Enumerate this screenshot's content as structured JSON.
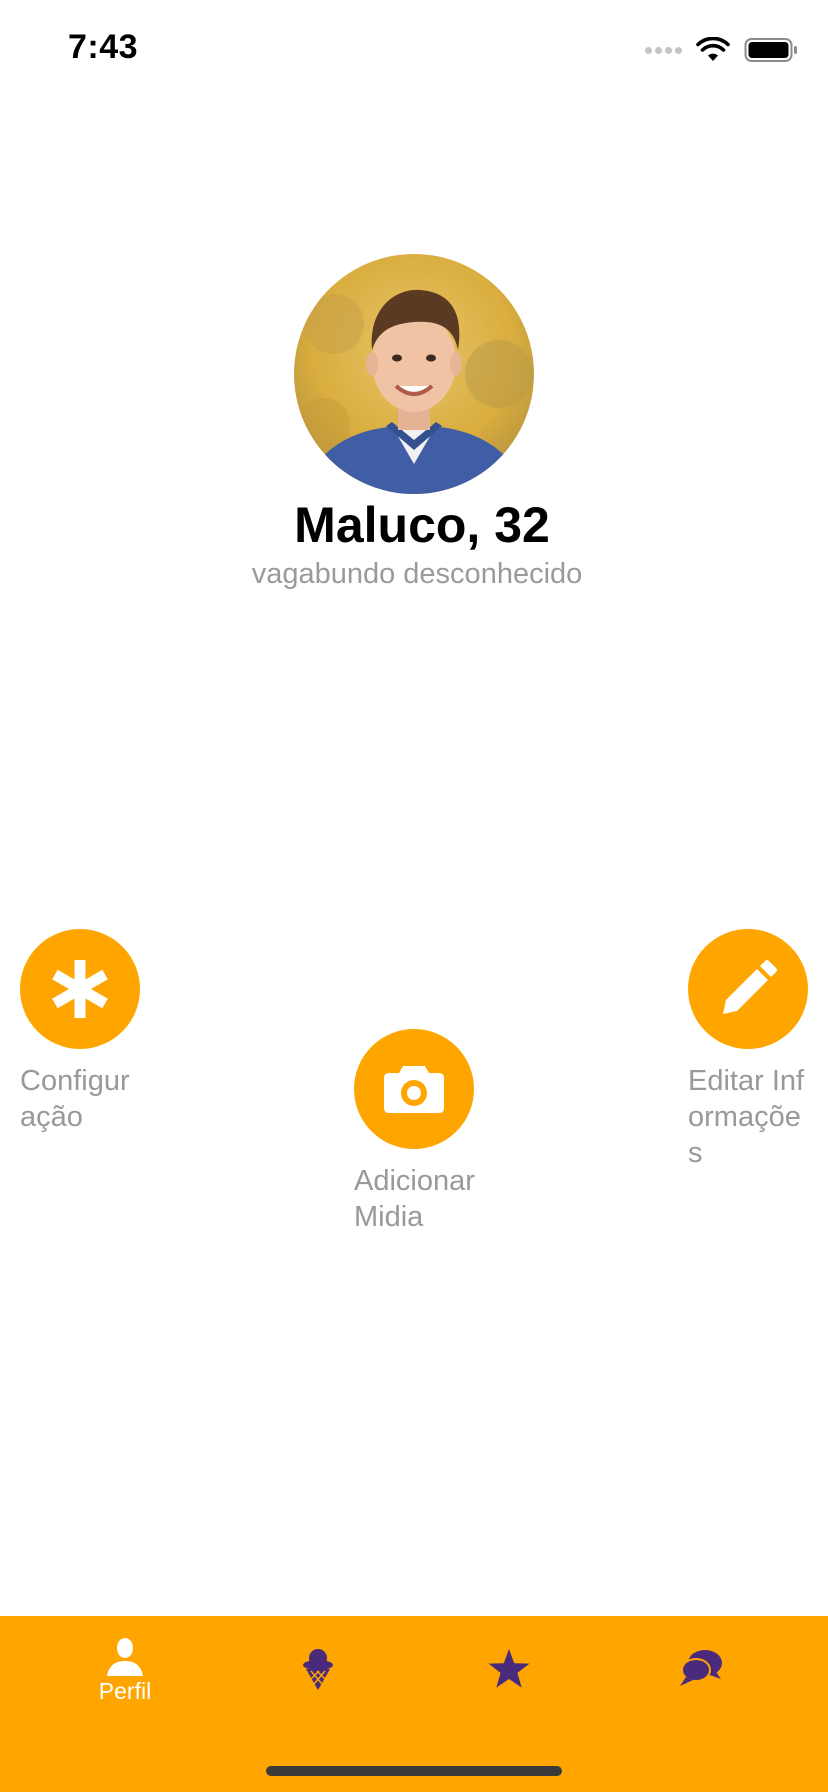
{
  "status_bar": {
    "time": "7:43"
  },
  "profile": {
    "name": "Maluco, 32",
    "subtitle": "vagabundo desconhecido",
    "avatar_icon": "profile-photo"
  },
  "actions": {
    "config": {
      "label": "Configuração",
      "icon": "asterisk-icon"
    },
    "media": {
      "label": "Adicionar Midia",
      "icon": "camera-icon"
    },
    "edit": {
      "label": "Editar Informações",
      "icon": "pencil-icon"
    }
  },
  "tab_bar": {
    "items": [
      {
        "label": "Perfil",
        "icon": "person-icon",
        "active": true
      },
      {
        "label": "",
        "icon": "ice-cream-icon",
        "active": false
      },
      {
        "label": "",
        "icon": "star-icon",
        "active": false
      },
      {
        "label": "",
        "icon": "chat-bubbles-icon",
        "active": false
      }
    ]
  },
  "colors": {
    "accent": "#FFA500",
    "tab_icon": "#4A2A7A",
    "muted_text": "#999999"
  }
}
